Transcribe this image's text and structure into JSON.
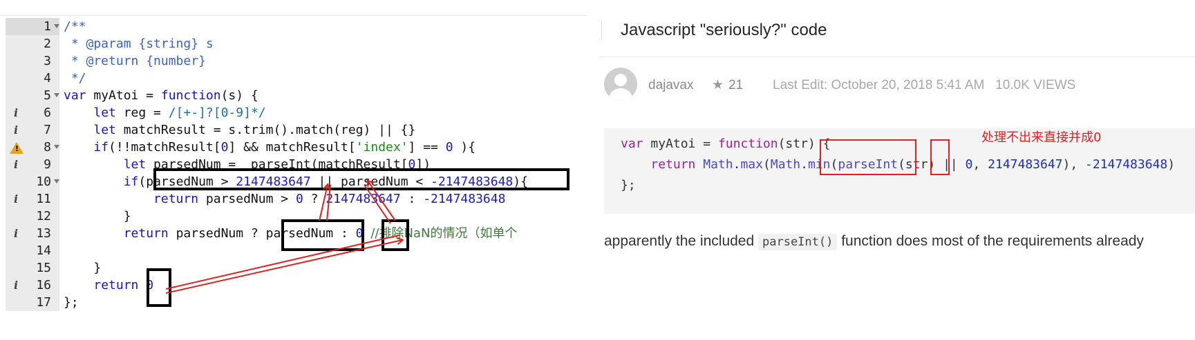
{
  "editor": {
    "lines": [
      {
        "n": "1",
        "text": "/**"
      },
      {
        "n": "2",
        "text": " * @param {string} s"
      },
      {
        "n": "3",
        "text": " * @return {number}"
      },
      {
        "n": "4",
        "text": " */"
      },
      {
        "n": "5",
        "text": "var myAtoi = function(s) {"
      },
      {
        "n": "6",
        "text": "    let reg = /[+-]?[0-9]*/"
      },
      {
        "n": "7",
        "text": "    let matchResult = s.trim().match(reg) || {}"
      },
      {
        "n": "8",
        "text": "    if(!!matchResult[0] && matchResult['index'] == 0 ){"
      },
      {
        "n": "9",
        "text": "        let parsedNum =  parseInt(matchResult[0])"
      },
      {
        "n": "10",
        "text": "        if(parsedNum > 2147483647 || parsedNum < -2147483648){"
      },
      {
        "n": "11",
        "text": "            return parsedNum > 0 ? 2147483647 : -2147483648"
      },
      {
        "n": "12",
        "text": "        }"
      },
      {
        "n": "13",
        "text": "        return parsedNum ? parsedNum : 0 //排除NaN的情况（如单个"
      },
      {
        "n": "14",
        "text": ""
      },
      {
        "n": "15",
        "text": "    }"
      },
      {
        "n": "16",
        "text": "    return 0"
      },
      {
        "n": "17",
        "text": "};"
      }
    ],
    "gutter_markers": {
      "info_lines": [
        "6",
        "7",
        "9",
        "11",
        "13",
        "16"
      ],
      "warning_line": "8",
      "info_symbol": "i",
      "warning_symbol": "!"
    }
  },
  "post": {
    "title": "Javascript \"seriously?\" code",
    "author": "dajavax",
    "star_icon": "★",
    "votes": "21",
    "meta": "Last Edit: October 20, 2018 5:41 AM   10.0K VIEWS",
    "code_lines": [
      "var myAtoi = function(str) {",
      "    return Math.max(Math.min(parseInt(str) || 0, 2147483647), -2147483648)",
      "};"
    ],
    "annotation": "处理不出来直接并成0",
    "paragraph_before": "apparently the included ",
    "paragraph_code": "parseInt()",
    "paragraph_after": " function does most of the requirements already"
  },
  "colors": {
    "box": "#000000",
    "arrow": "#e02020",
    "annotation": "#e02020"
  }
}
